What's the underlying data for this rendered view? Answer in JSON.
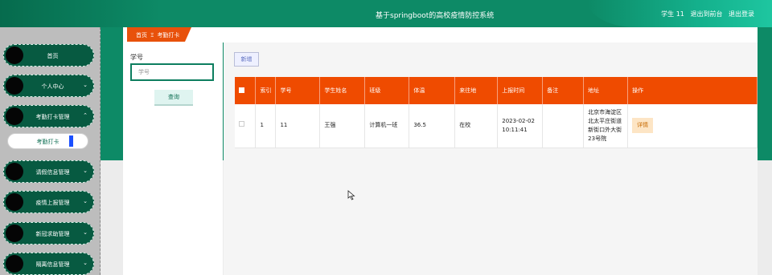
{
  "header": {
    "title": "基于springboot的高校疫情防控系统",
    "user_label": "学生 11",
    "back_link": "退出到前台",
    "logout_link": "退出登录"
  },
  "sidebar": {
    "items": [
      {
        "label": "首页"
      },
      {
        "label": "个人中心"
      },
      {
        "label": "考勤打卡管理"
      },
      {
        "label": "请假信息管理"
      },
      {
        "label": "疫情上报管理"
      },
      {
        "label": "新冠求助管理"
      },
      {
        "label": "隔离信息管理"
      }
    ],
    "submenu_active": "考勤打卡"
  },
  "breadcrumb": {
    "home": "首页",
    "separator": "Ξ",
    "current": "考勤打卡"
  },
  "search": {
    "label": "学号",
    "placeholder": "学号",
    "button": "查询"
  },
  "toolbar": {
    "add_label": "新增"
  },
  "table": {
    "columns": [
      "索引",
      "学号",
      "学生姓名",
      "班级",
      "体温",
      "来往地",
      "上报时间",
      "备注",
      "地址",
      "操作"
    ],
    "rows": [
      {
        "index": "1",
        "student_id": "11",
        "name": "王强",
        "class": "计算机一班",
        "temperature": "36.5",
        "location": "在校",
        "report_time": "2023-02-02 10:11:41",
        "note": "",
        "address": "北京市海淀区北太平庄街道新街口外大街23号院",
        "action": "详情"
      }
    ]
  },
  "colors": {
    "header_green": "#0d8a66",
    "sidebar_item": "#075a41",
    "table_header": "#ef4b00",
    "breadcrumb_tag": "#e8510b"
  }
}
